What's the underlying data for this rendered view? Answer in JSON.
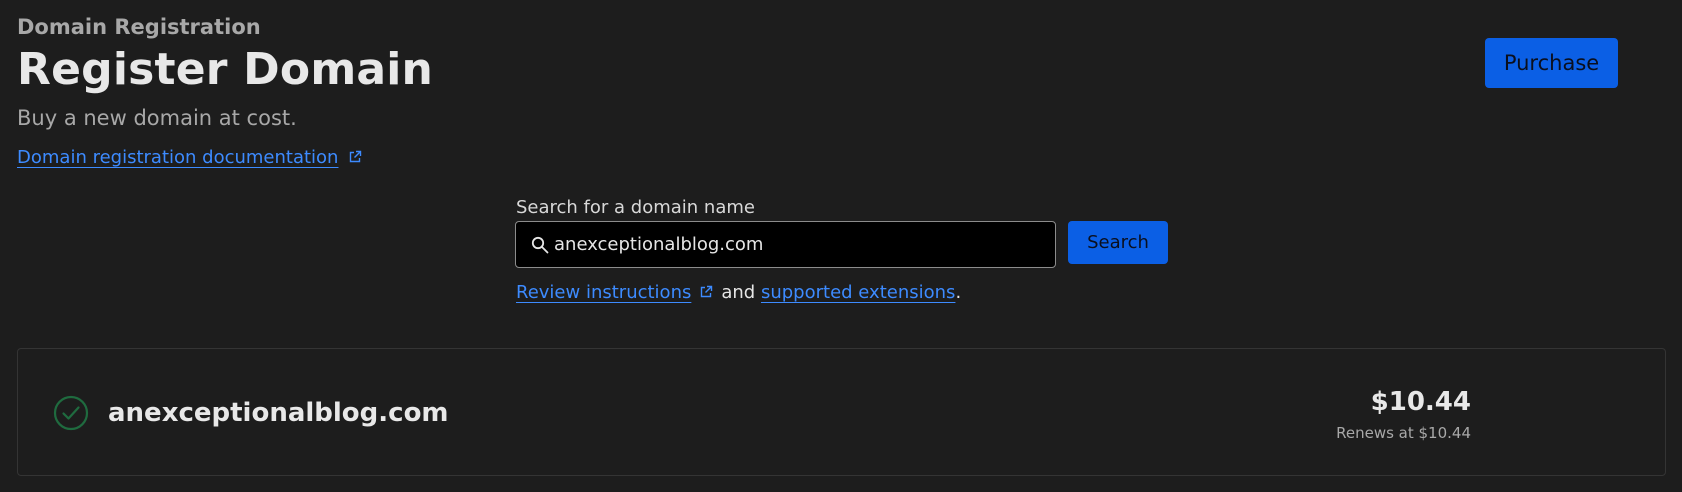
{
  "header": {
    "breadcrumb": "Domain Registration",
    "title": "Register Domain",
    "subtitle": "Buy a new domain at cost.",
    "doc_link": "Domain registration documentation"
  },
  "search": {
    "label": "Search for a domain name",
    "value": "anexceptionalblog.com",
    "placeholder": "",
    "button_label": "Search",
    "help_link_1": "Review instructions",
    "help_and": "and",
    "help_link_2": "supported extensions",
    "help_period": "."
  },
  "result": {
    "domain": "anexceptionalblog.com",
    "status_icon": "check-circle-icon",
    "price": "$10.44",
    "renews": "Renews at $10.44",
    "purchase_label": "Purchase"
  },
  "colors": {
    "background": "#1d1d1d",
    "accent": "#0b5fe5",
    "link": "#3d8bff",
    "success": "#1f6b3f"
  }
}
